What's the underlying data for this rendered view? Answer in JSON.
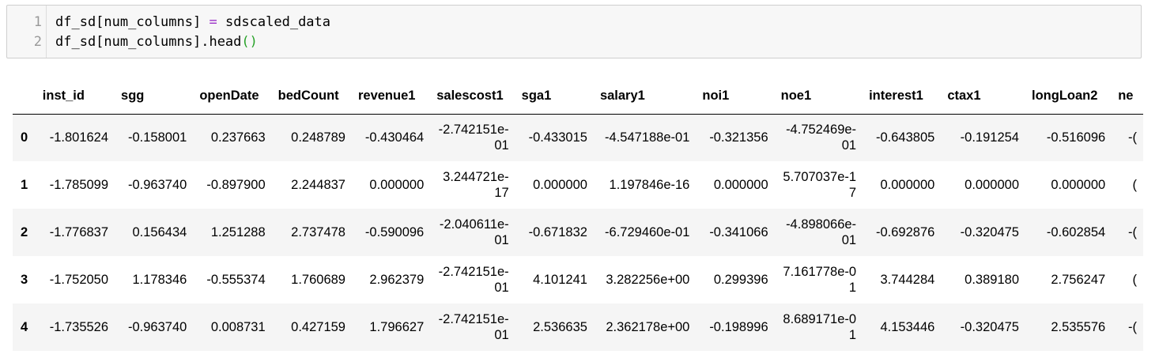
{
  "code": {
    "line_numbers": [
      "1",
      "2"
    ],
    "line1": {
      "target": "df_sd[num_columns] ",
      "operator": "=",
      "value": " sdscaled_data"
    },
    "line2": {
      "text": "df_sd[num_columns].head",
      "parens": "()"
    }
  },
  "table": {
    "columns": [
      "inst_id",
      "sgg",
      "openDate",
      "bedCount",
      "revenue1",
      "salescost1",
      "sga1",
      "salary1",
      "noi1",
      "noe1",
      "interest1",
      "ctax1",
      "longLoan2",
      "ne"
    ],
    "rows": [
      {
        "index": "0",
        "cells": [
          "-1.801624",
          "-0.158001",
          "0.237663",
          "0.248789",
          "-0.430464",
          "-2.742151e-01",
          "-0.433015",
          "-4.547188e-01",
          "-0.321356",
          "-4.752469e-01",
          "-0.643805",
          "-0.191254",
          "-0.516096",
          "-("
        ]
      },
      {
        "index": "1",
        "cells": [
          "-1.785099",
          "-0.963740",
          "-0.897900",
          "2.244837",
          "0.000000",
          "3.244721e-17",
          "0.000000",
          "1.197846e-16",
          "0.000000",
          "5.707037e-17",
          "0.000000",
          "0.000000",
          "0.000000",
          "("
        ]
      },
      {
        "index": "2",
        "cells": [
          "-1.776837",
          "0.156434",
          "1.251288",
          "2.737478",
          "-0.590096",
          "-2.040611e-01",
          "-0.671832",
          "-6.729460e-01",
          "-0.341066",
          "-4.898066e-01",
          "-0.692876",
          "-0.320475",
          "-0.602854",
          "-("
        ]
      },
      {
        "index": "3",
        "cells": [
          "-1.752050",
          "1.178346",
          "-0.555374",
          "1.760689",
          "2.962379",
          "-2.742151e-01",
          "4.101241",
          "3.282256e+00",
          "0.299396",
          "7.161778e-01",
          "3.744284",
          "0.389180",
          "2.756247",
          "("
        ]
      },
      {
        "index": "4",
        "cells": [
          "-1.735526",
          "-0.963740",
          "0.008731",
          "0.427159",
          "1.796627",
          "-2.742151e-01",
          "2.536635",
          "2.362178e+00",
          "-0.198996",
          "8.689171e-01",
          "4.153446",
          "-0.320475",
          "2.535576",
          "-("
        ]
      }
    ]
  }
}
